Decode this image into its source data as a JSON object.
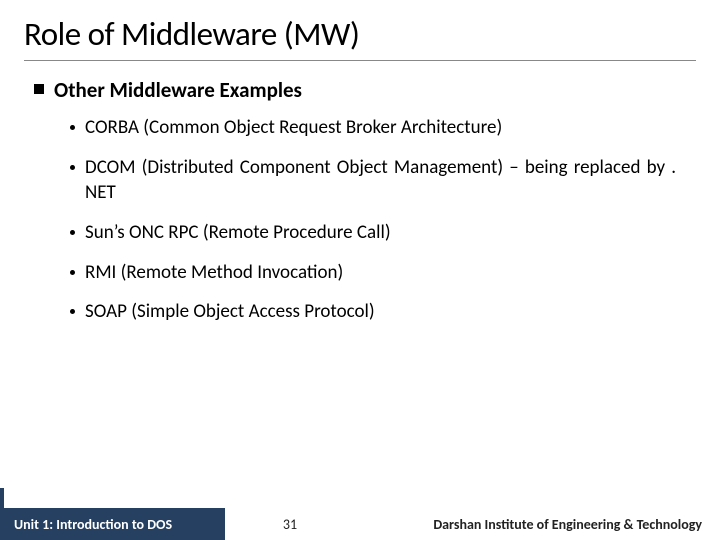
{
  "title": "Role of Middleware (MW)",
  "section_heading": "Other Middleware Examples",
  "bullets": {
    "b0": "CORBA (Common Object Request Broker Architecture)",
    "b1": "DCOM (Distributed Component Object Management) – being replaced by . NET",
    "b2": "Sun’s ONC RPC (Remote Procedure Call)",
    "b3": "RMI (Remote Method Invocation)",
    "b4": "SOAP (Simple Object Access Protocol)"
  },
  "footer": {
    "left": "Unit 1: Introduction to DOS",
    "page": "31",
    "right": "Darshan Institute of Engineering & Technology"
  }
}
